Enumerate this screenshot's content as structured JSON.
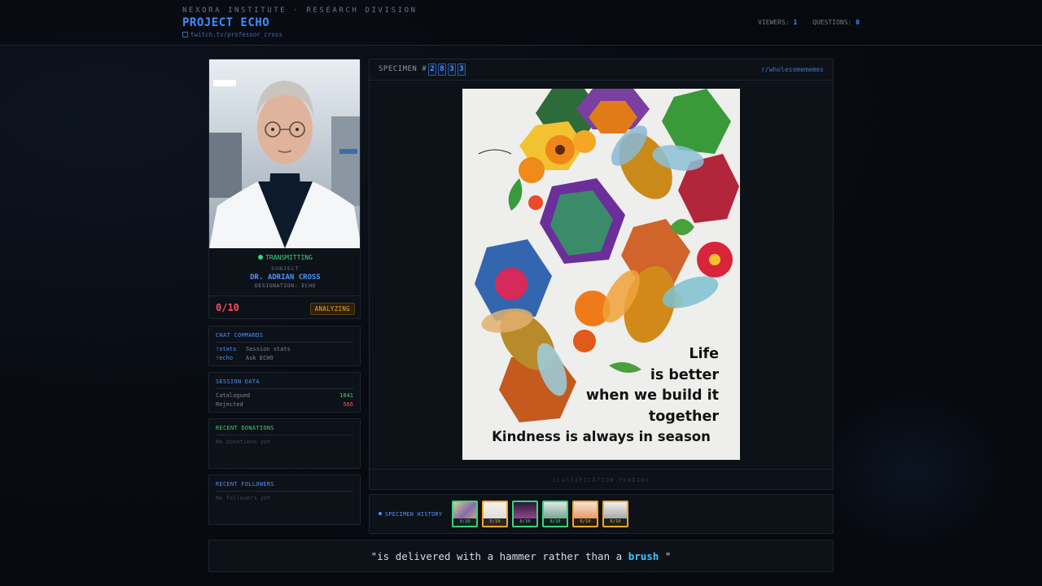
{
  "header": {
    "org": "NEXORA INSTITUTE · RESEARCH DIVISION",
    "project": "PROJECT ECHO",
    "channel": "twitch.tv/professor_cross",
    "viewers_label": "VIEWERS:",
    "viewers": "1",
    "questions_label": "QUESTIONS:",
    "questions": "0"
  },
  "subject": {
    "status": "TRANSMITTING",
    "label": "SUBJECT",
    "name": "DR. ADRIAN CROSS",
    "designation": "DESIGNATION: ECHO",
    "score": "0/10",
    "state_badge": "ANALYZING"
  },
  "chat_commands": {
    "title": "CHAT COMMANDS",
    "items": [
      {
        "cmd": "!stats",
        "desc": "Session stats"
      },
      {
        "cmd": "!echo",
        "desc": "Ask ECHO"
      }
    ]
  },
  "session_data": {
    "title": "SESSION DATA",
    "catalogued_label": "Catalogued",
    "catalogued": "1841",
    "rejected_label": "Rejected",
    "rejected": "566"
  },
  "donations": {
    "title": "RECENT DONATIONS",
    "empty": "No donations yet"
  },
  "followers": {
    "title": "RECENT FOLLOWERS",
    "empty": "No followers yet"
  },
  "specimen": {
    "label": "SPECIMEN #",
    "digits": [
      "2",
      "8",
      "3",
      "3"
    ],
    "source": "r/wholesomememes",
    "poster_lines": [
      "Life",
      "is better",
      "when we build it",
      "together"
    ],
    "poster_tagline": "Kindness is always in season",
    "footer": "CLASSIFICATION PENDING"
  },
  "history": {
    "label": "SPECIMEN HISTORY",
    "items": [
      {
        "score": "9/10",
        "status": "green"
      },
      {
        "score": "5/10",
        "status": "orange"
      },
      {
        "score": "8/10",
        "status": "green"
      },
      {
        "score": "8/10",
        "status": "green"
      },
      {
        "score": "6/10",
        "status": "orange"
      },
      {
        "score": "6/10",
        "status": "orange"
      }
    ]
  },
  "quote": {
    "before": "\"is delivered with a hammer rather than a ",
    "highlight": "brush",
    "after": " \""
  },
  "colors": {
    "accent_blue": "#3f8cff",
    "success_green": "#37d67a",
    "danger_red": "#ff4d5e",
    "warning_orange": "#f5a623",
    "highlight_cyan": "#3fc6ff"
  }
}
